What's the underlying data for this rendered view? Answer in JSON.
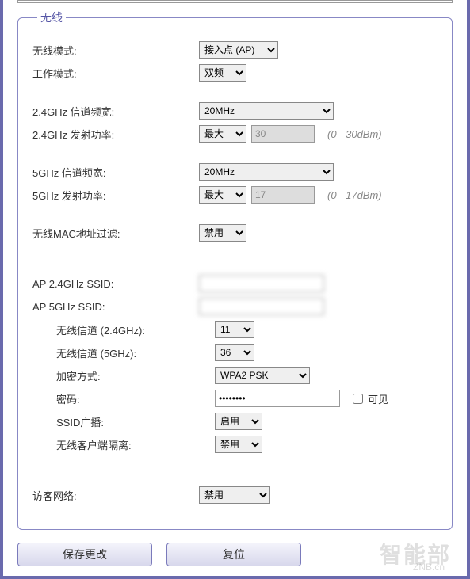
{
  "fieldset_title": "无线",
  "wireless_mode": {
    "label": "无线模式:",
    "value": "接入点 (AP)"
  },
  "work_mode": {
    "label": "工作模式:",
    "value": "双频"
  },
  "ch24_width": {
    "label": "2.4GHz 信道频宽:",
    "value": "20MHz"
  },
  "tx24_power": {
    "label": "2.4GHz 发射功率:",
    "value": "最大",
    "num": "30",
    "hint": "(0 - 30dBm)"
  },
  "ch5_width": {
    "label": "5GHz 信道频宽:",
    "value": "20MHz"
  },
  "tx5_power": {
    "label": "5GHz 发射功率:",
    "value": "最大",
    "num": "17",
    "hint": "(0 - 17dBm)"
  },
  "mac_filter": {
    "label": "无线MAC地址过滤:",
    "value": "禁用"
  },
  "ssid24": {
    "label": "AP 2.4GHz SSID:",
    "value": ""
  },
  "ssid5": {
    "label": "AP 5GHz SSID:",
    "value": ""
  },
  "chan24": {
    "label": "无线信道 (2.4GHz):",
    "value": "11"
  },
  "chan5": {
    "label": "无线信道 (5GHz):",
    "value": "36"
  },
  "encryption": {
    "label": "加密方式:",
    "value": "WPA2 PSK"
  },
  "password": {
    "label": "密码:",
    "value": "••••••••",
    "visible_label": "可见"
  },
  "ssid_bcast": {
    "label": "SSID广播:",
    "value": "启用"
  },
  "isolation": {
    "label": "无线客户端隔离:",
    "value": "禁用"
  },
  "guest": {
    "label": "访客网络:",
    "value": "禁用"
  },
  "buttons": {
    "save": "保存更改",
    "reset": "复位"
  },
  "watermark": "智能部",
  "watermark_sub": "ZNB.cn"
}
